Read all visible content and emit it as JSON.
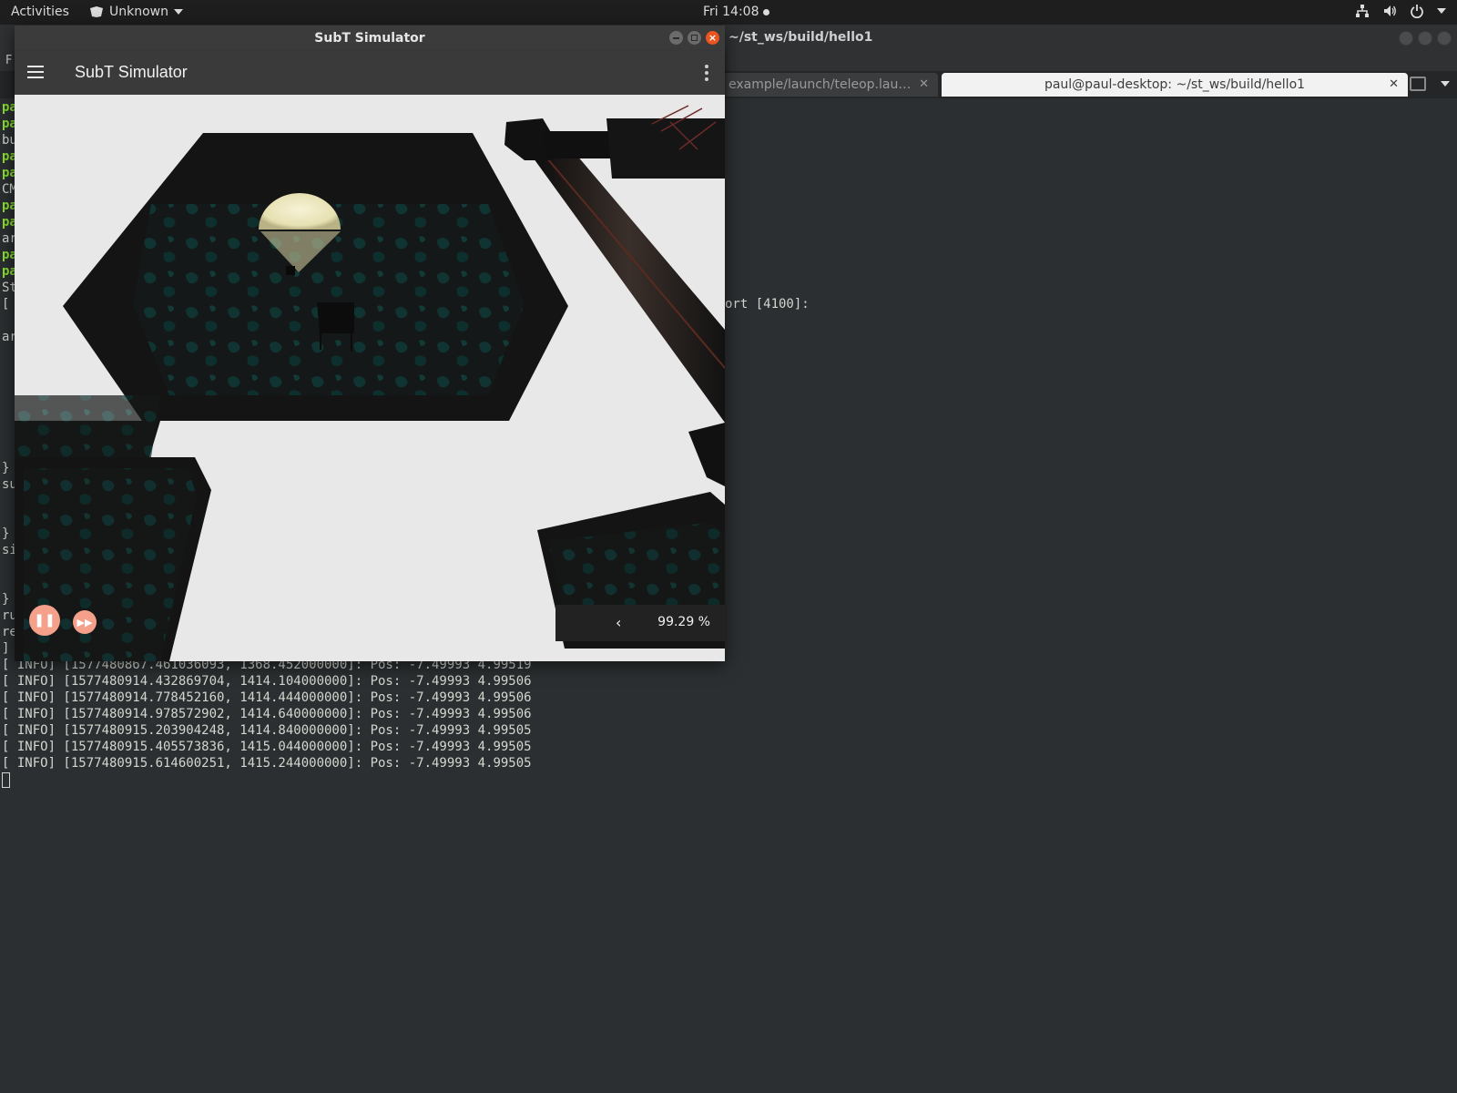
{
  "topbar": {
    "activities": "Activities",
    "app_menu": "Unknown",
    "clock": "Fri 14:08",
    "tray_icons": [
      "network-icon",
      "volume-icon",
      "power-icon"
    ]
  },
  "terminal": {
    "window_title": "~/st_ws/build/hello1",
    "menu_first_letter": "F",
    "tabs": [
      {
        "label": "example/launch/teleop.lau…",
        "active": false
      },
      {
        "label": "paul@paul-desktop: ~/st_ws/build/hello1",
        "active": true
      }
    ],
    "partial_left": [
      "pa",
      "pa",
      "bu",
      "pa",
      "pa",
      "CM",
      "pa",
      "pa",
      "ar",
      "pa",
      "pa",
      "St",
      "[",
      "  [",
      "ar"
    ],
    "partial_right": "ort [4100]:",
    "partial_bottom": [
      "}",
      "su",
      "}",
      "si",
      "}",
      "ru",
      "re",
      "]"
    ],
    "log_lines": [
      "[ INFO] [1577480867.461036093, 1368.452000000]: Pos: -7.49993 4.99519",
      "[ INFO] [1577480914.432869704, 1414.104000000]: Pos: -7.49993 4.99506",
      "[ INFO] [1577480914.778452160, 1414.444000000]: Pos: -7.49993 4.99506",
      "[ INFO] [1577480914.978572902, 1414.640000000]: Pos: -7.49993 4.99506",
      "[ INFO] [1577480915.203904248, 1414.840000000]: Pos: -7.49993 4.99505",
      "[ INFO] [1577480915.405573836, 1415.044000000]: Pos: -7.49993 4.99505",
      "[ INFO] [1577480915.614600251, 1415.244000000]: Pos: -7.49993 4.99505"
    ]
  },
  "simulator": {
    "window_title": "SubT Simulator",
    "app_title": "SubT Simulator",
    "real_time_factor": "99.29 %",
    "colors": {
      "accent": "#f4a08a",
      "close": "#e95420"
    }
  }
}
